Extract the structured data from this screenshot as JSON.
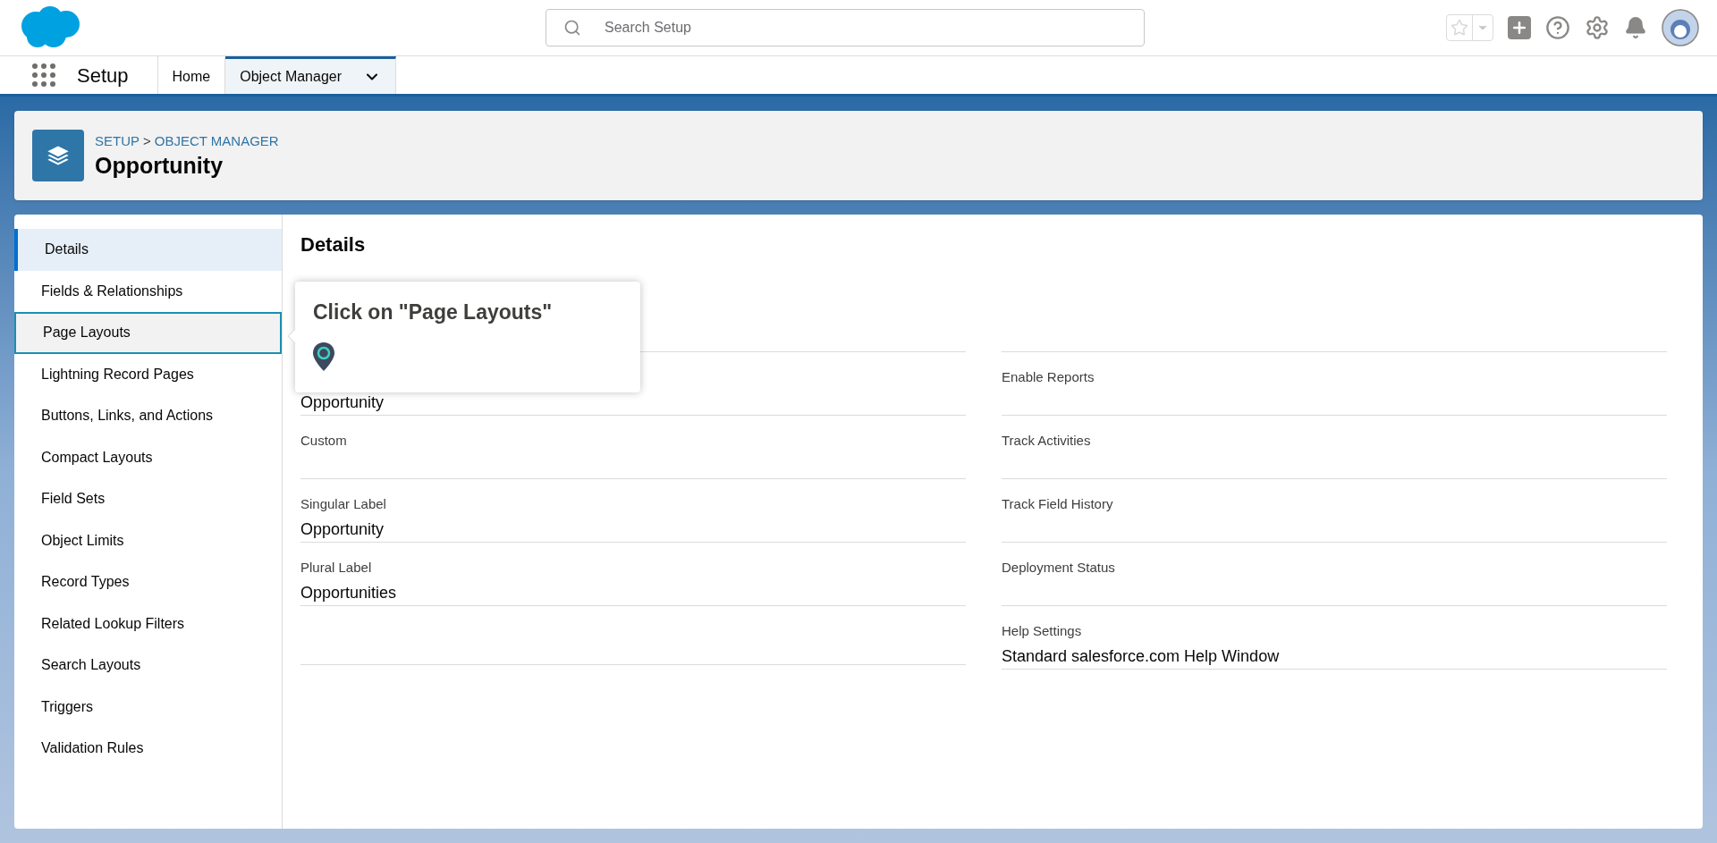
{
  "header": {
    "search": {
      "placeholder": "Search Setup"
    }
  },
  "nav": {
    "app_name": "Setup",
    "tabs": [
      {
        "label": "Home",
        "selected": false,
        "dropdown": false
      },
      {
        "label": "Object Manager",
        "selected": true,
        "dropdown": true
      }
    ]
  },
  "page_header": {
    "breadcrumb": [
      "SETUP",
      "OBJECT MANAGER"
    ],
    "separator": ">",
    "title": "Opportunity"
  },
  "sidebar": {
    "items": [
      {
        "label": "Details",
        "selected": true,
        "highlighted": false
      },
      {
        "label": "Fields & Relationships",
        "selected": false,
        "highlighted": false
      },
      {
        "label": "Page Layouts",
        "selected": false,
        "highlighted": true
      },
      {
        "label": "Lightning Record Pages",
        "selected": false,
        "highlighted": false
      },
      {
        "label": "Buttons, Links, and Actions",
        "selected": false,
        "highlighted": false
      },
      {
        "label": "Compact Layouts",
        "selected": false,
        "highlighted": false
      },
      {
        "label": "Field Sets",
        "selected": false,
        "highlighted": false
      },
      {
        "label": "Object Limits",
        "selected": false,
        "highlighted": false
      },
      {
        "label": "Record Types",
        "selected": false,
        "highlighted": false
      },
      {
        "label": "Related Lookup Filters",
        "selected": false,
        "highlighted": false
      },
      {
        "label": "Search Layouts",
        "selected": false,
        "highlighted": false
      },
      {
        "label": "Triggers",
        "selected": false,
        "highlighted": false
      },
      {
        "label": "Validation Rules",
        "selected": false,
        "highlighted": false
      }
    ]
  },
  "details": {
    "title": "Details",
    "left_fields": [
      {
        "value": "Opportunity"
      },
      {
        "label": "Custom"
      },
      {
        "label": "Singular Label",
        "value": "Opportunity"
      },
      {
        "label": "Plural Label",
        "value": "Opportunities"
      }
    ],
    "right_fields": [
      {
        "label": "Enable Reports"
      },
      {
        "label": "Track Activities"
      },
      {
        "label": "Track Field History"
      },
      {
        "label": "Deployment Status"
      },
      {
        "label": "Help Settings",
        "value": "Standard salesforce.com Help Window"
      }
    ]
  },
  "tour_popup": {
    "text": "Click on \"Page Layouts\""
  }
}
